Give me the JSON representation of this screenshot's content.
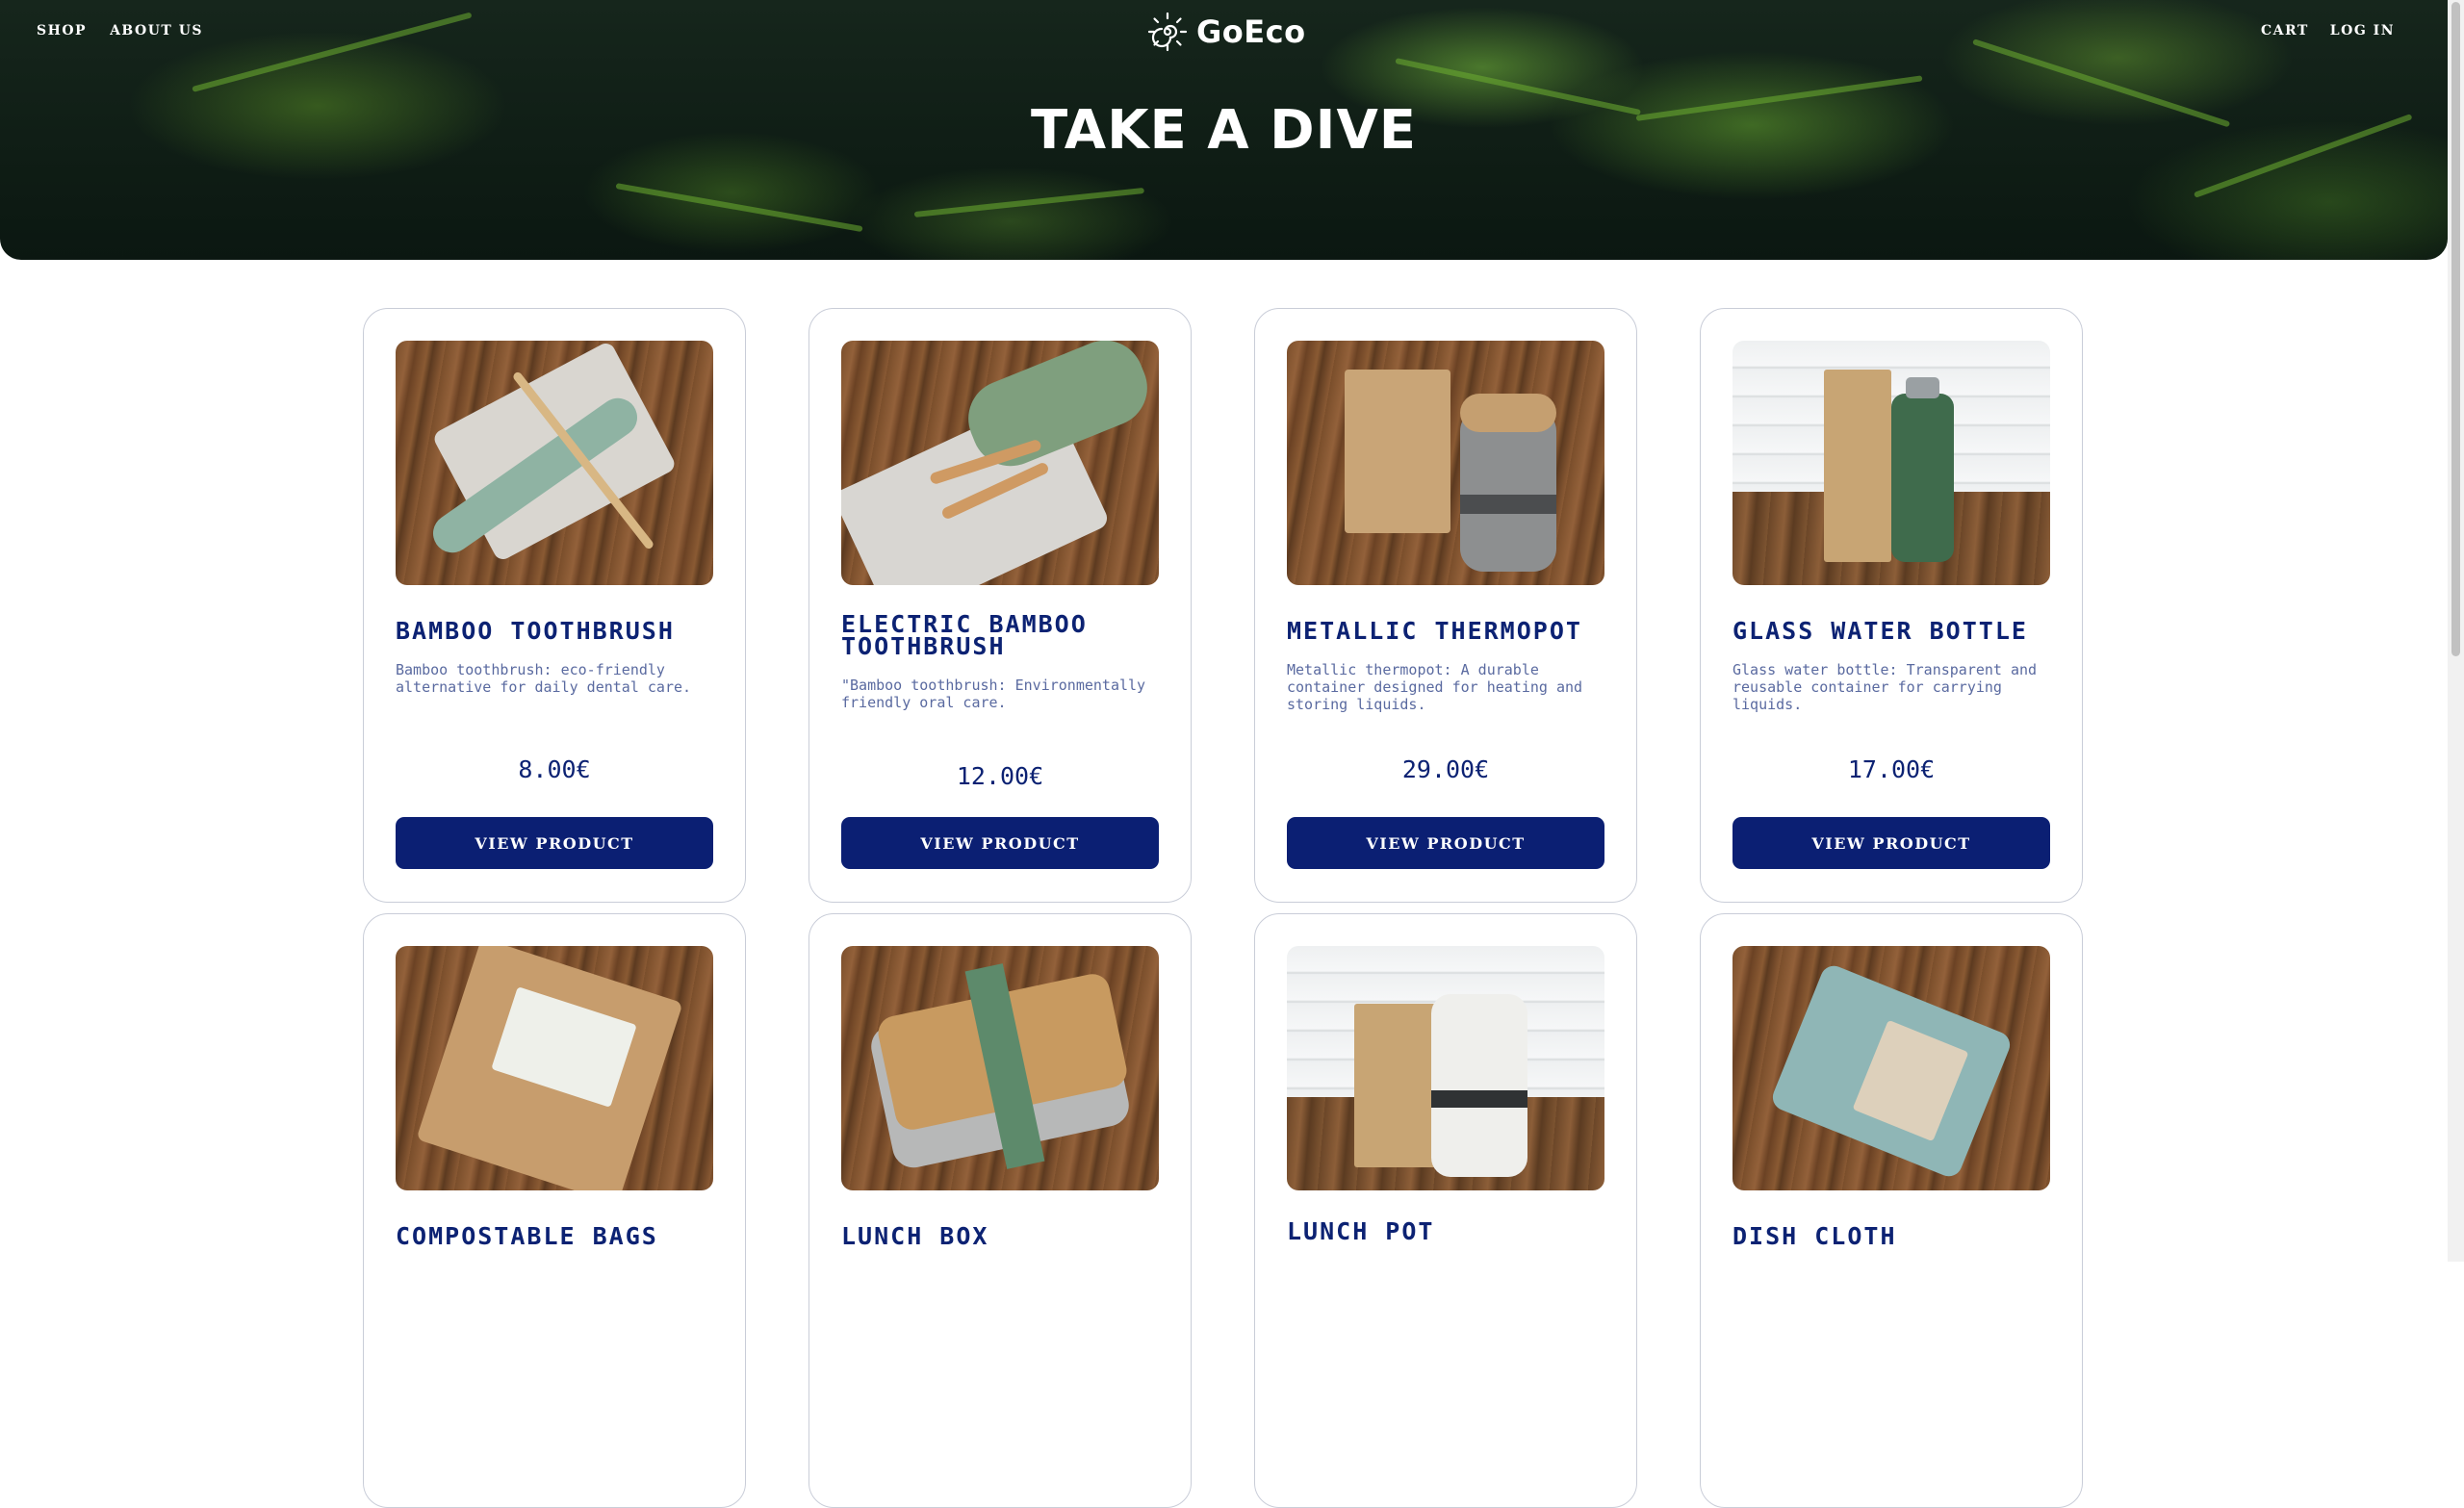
{
  "nav": {
    "left": [
      "SHOP",
      "ABOUT US"
    ],
    "right": [
      "CART",
      "LOG IN"
    ]
  },
  "brand": {
    "name": "GoEco"
  },
  "hero": {
    "title": "TAKE A DIVE"
  },
  "colors": {
    "accent": "#0b1f73",
    "title": "#0c2273",
    "description": "#5a6aa0",
    "card_border": "#c9cdd8"
  },
  "products": [
    {
      "name": "BAMBOO TOOTHBRUSH",
      "description": "Bamboo toothbrush: eco-friendly alternative for daily dental care.",
      "price": "8.00€",
      "button": "VIEW PRODUCT",
      "image": "bamboo-toothbrush-photo"
    },
    {
      "name": "ELECTRIC BAMBOO TOOTHBRUSH",
      "description": "\"Bamboo toothbrush: Environmentally friendly oral care.",
      "price": "12.00€",
      "button": "VIEW PRODUCT",
      "image": "electric-bamboo-toothbrush-photo"
    },
    {
      "name": "METALLIC THERMOPOT",
      "description": "Metallic thermopot: A durable container designed for heating and storing liquids.",
      "price": "29.00€",
      "button": "VIEW PRODUCT",
      "image": "metallic-thermopot-photo"
    },
    {
      "name": "GLASS WATER BOTTLE",
      "description": "Glass water bottle: Transparent and reusable container for carrying liquids.",
      "price": "17.00€",
      "button": "VIEW PRODUCT",
      "image": "glass-water-bottle-photo"
    },
    {
      "name": "COMPOSTABLE BAGS",
      "image": "compostable-bags-photo"
    },
    {
      "name": "LUNCH BOX",
      "image": "lunch-box-photo"
    },
    {
      "name": "LUNCH POT",
      "image": "lunch-pot-photo"
    },
    {
      "name": "DISH CLOTH",
      "image": "dish-cloth-photo"
    }
  ]
}
